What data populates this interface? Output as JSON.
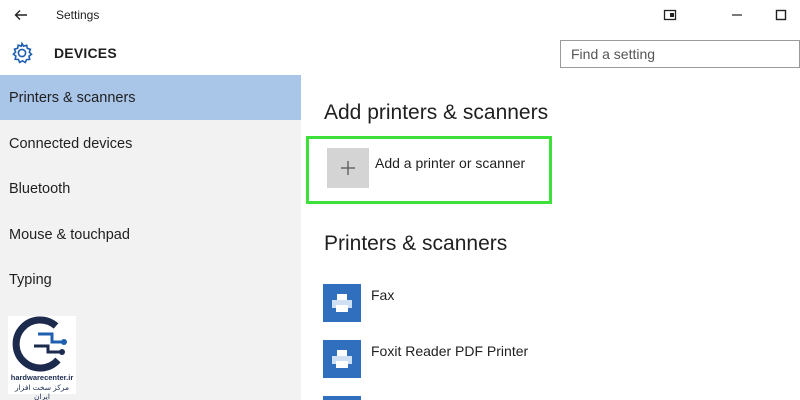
{
  "window": {
    "title": "Settings"
  },
  "header": {
    "title": "DEVICES",
    "search_placeholder": "Find a setting"
  },
  "sidebar": {
    "items": [
      {
        "label": "Printers & scanners",
        "active": true
      },
      {
        "label": "Connected devices",
        "active": false
      },
      {
        "label": "Bluetooth",
        "active": false
      },
      {
        "label": "Mouse & touchpad",
        "active": false
      },
      {
        "label": "Typing",
        "active": false
      }
    ]
  },
  "main": {
    "add_section_title": "Add printers & scanners",
    "add_button_label": "Add a printer or scanner",
    "list_section_title": "Printers & scanners",
    "printers": [
      {
        "name": "Fax"
      },
      {
        "name": "Foxit Reader PDF Printer"
      }
    ]
  },
  "logo": {
    "line1": "hardwarecenter.ir",
    "line2": "مرکز سخت افزار ایران"
  },
  "colors": {
    "sidebar_bg": "#f2f2f2",
    "active_item": "#a9c5e8",
    "highlight_border": "#3ee03a",
    "printer_icon": "#2f6fbd",
    "accent": "#1f5fb0"
  },
  "icons": {
    "back": "back-arrow-icon",
    "gear": "gear-icon",
    "add": "plus-icon",
    "printer": "printer-icon",
    "minimize": "minimize-icon",
    "maximize": "maximize-icon",
    "tablet": "tablet-mode-icon"
  }
}
